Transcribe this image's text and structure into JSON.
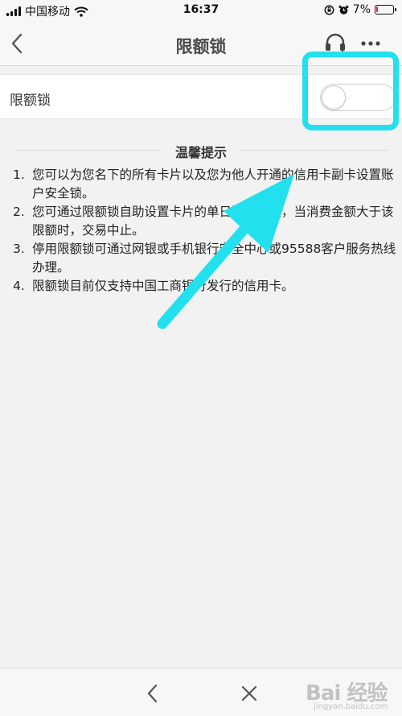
{
  "status_bar": {
    "carrier": "中国移动",
    "time": "16:37",
    "battery": "7%",
    "battery_level": 0.07,
    "icons": [
      "signal-icon",
      "wifi-icon",
      "orientation-lock-icon",
      "alarm-icon",
      "battery-icon"
    ]
  },
  "nav": {
    "title": "限额锁",
    "icons": [
      "back-chevron-icon",
      "headset-icon",
      "more-dots-icon"
    ]
  },
  "lock_setting": {
    "label": "限额锁",
    "enabled": false
  },
  "tips": {
    "title": "温馨提示",
    "items": [
      {
        "num": "1.",
        "text": "您可以为您名下的所有卡片以及您为他人开通的信用卡副卡设置账户安全锁。"
      },
      {
        "num": "2.",
        "text": "您可通过限额锁自助设置卡片的单日消费限额，当消费金额大于该限额时，交易中止。"
      },
      {
        "num": "3.",
        "text": "停用限额锁可通过网银或手机银行安全中心或95588客户服务热线办理。"
      },
      {
        "num": "4.",
        "text": "限额锁目前仅支持中国工商银行发行的信用卡。"
      }
    ]
  },
  "annotation": {
    "color": "#22e0ee"
  },
  "bottom_bar": {
    "icons": [
      "back-icon",
      "close-icon"
    ]
  },
  "watermark": {
    "main": "Bai 经验",
    "sub": "jingyan.baidu.com"
  }
}
